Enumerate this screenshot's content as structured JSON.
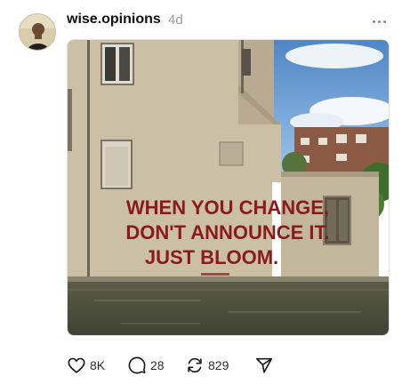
{
  "post": {
    "username": "wise.opinions",
    "timestamp": "4d",
    "more_icon": "more-horizontal-icon",
    "image": {
      "graffiti_lines": [
        "WHEN YOU CHANGE,",
        "DON'T ANNOUNCE IT.",
        "JUST BLOOM."
      ],
      "graffiti_color": "#8b1a1a"
    },
    "actions": {
      "like_count": "8K",
      "reply_count": "28",
      "repost_count": "829",
      "like_icon": "heart-icon",
      "reply_icon": "comment-icon",
      "repost_icon": "repost-icon",
      "share_icon": "send-icon"
    }
  }
}
